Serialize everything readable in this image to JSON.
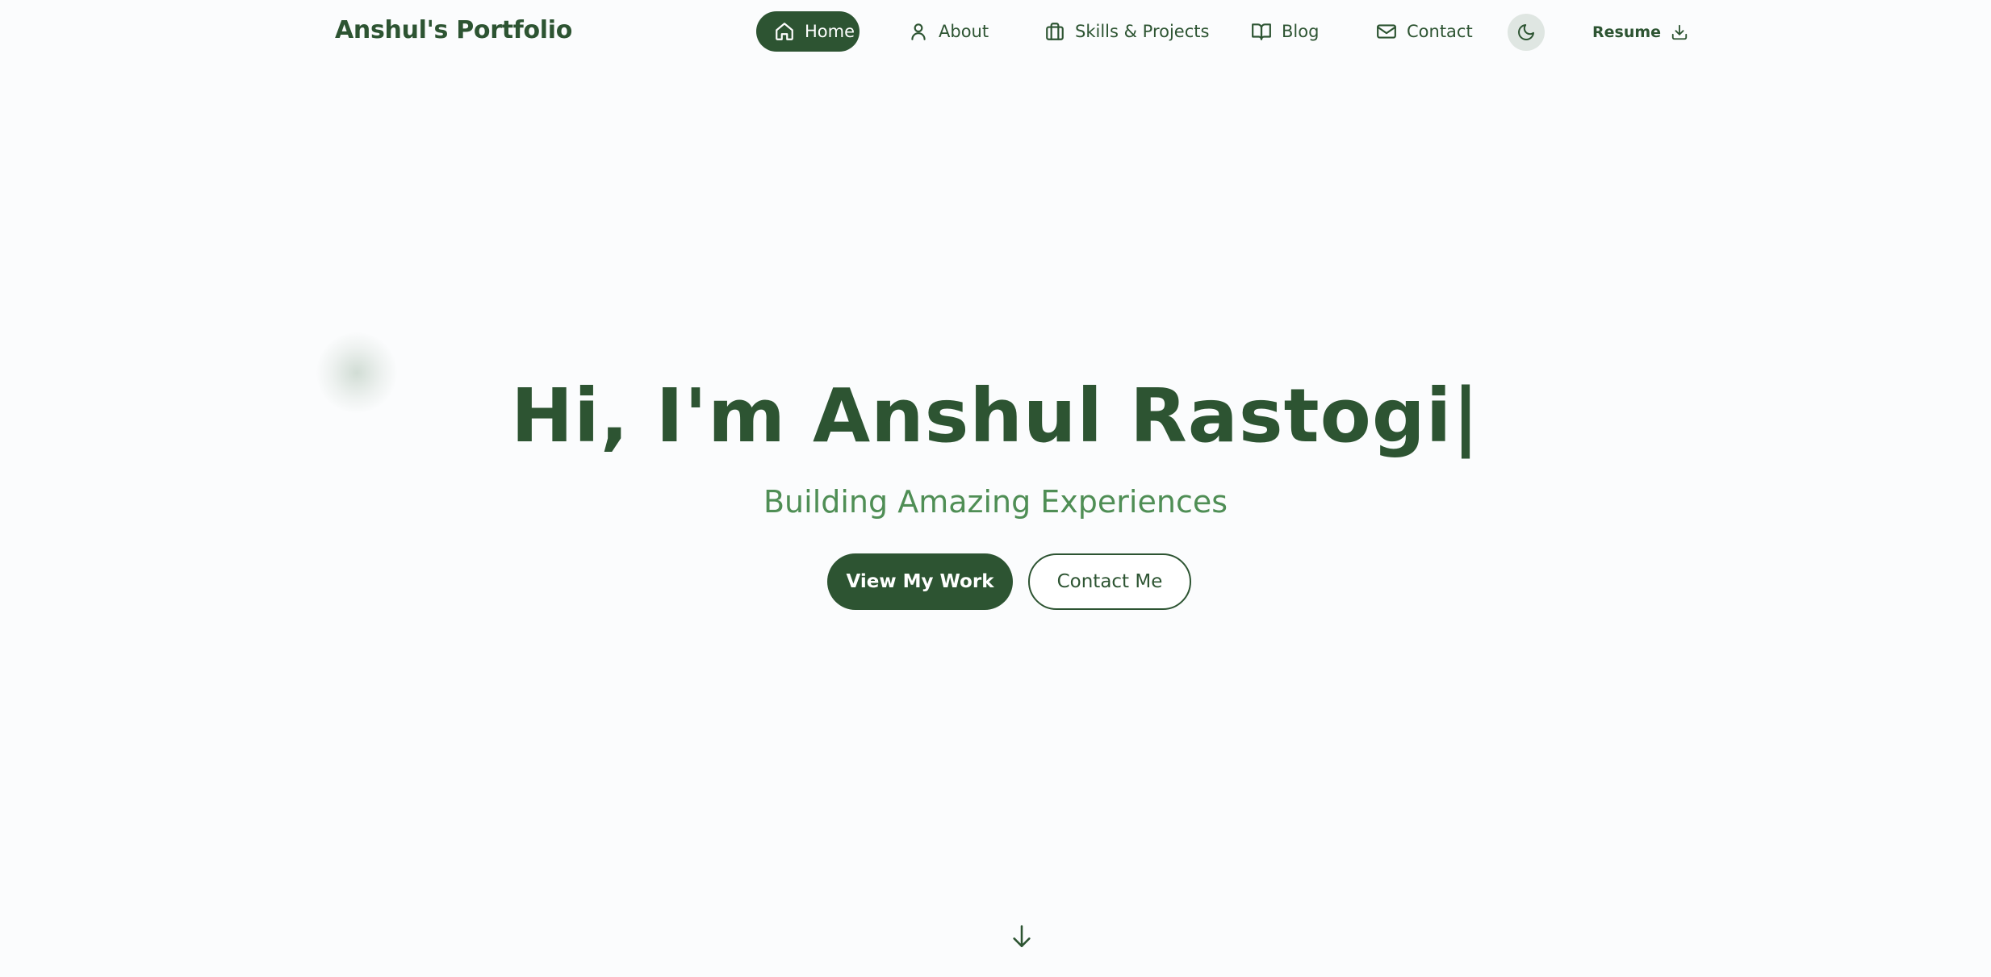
{
  "brand": {
    "title": "Anshul's Portfolio"
  },
  "nav": {
    "items": [
      {
        "label": "Home",
        "icon": "home-icon",
        "active": true
      },
      {
        "label": "About",
        "icon": "user-icon",
        "active": false
      },
      {
        "label": "Skills & Projects",
        "icon": "briefcase-icon",
        "active": false
      },
      {
        "label": "Blog",
        "icon": "book-icon",
        "active": false
      },
      {
        "label": "Contact",
        "icon": "mail-icon",
        "active": false
      }
    ],
    "theme_toggle_icon": "moon-icon",
    "resume": {
      "label": "Resume",
      "icon": "download-icon"
    }
  },
  "hero": {
    "title": "Hi, I'm Anshul Rastogi|",
    "subtitle": "Building Amazing Experiences",
    "primary_button": "View My Work",
    "secondary_button": "Contact Me",
    "scroll_icon": "arrow-down-icon"
  },
  "colors": {
    "primary": "#2d5432",
    "accent": "#4f8e55",
    "background": "#fbfcfd",
    "toggle_background": "#dfe6e2"
  }
}
